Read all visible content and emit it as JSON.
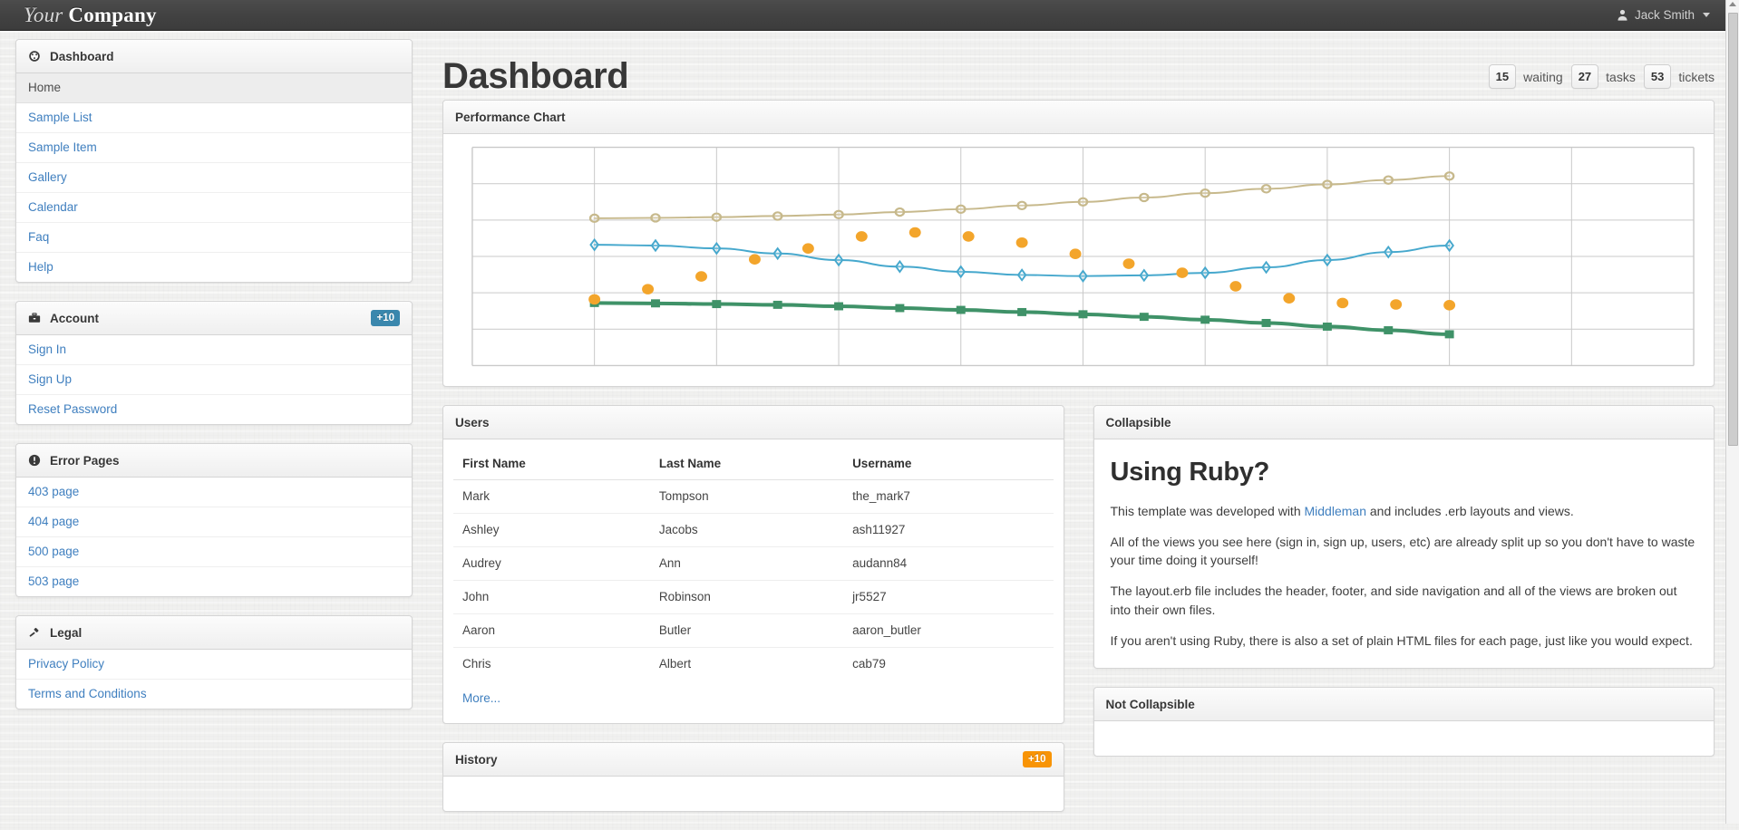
{
  "navbar": {
    "brand_first": "Your",
    "brand_second": "Company",
    "user_name": "Jack Smith",
    "user_icon": "user-icon",
    "caret_icon": "chevron-down-icon"
  },
  "sidebar": {
    "sections": [
      {
        "title": "Dashboard",
        "icon": "tachometer-icon",
        "badge": null,
        "items": [
          {
            "label": "Home",
            "active": true
          },
          {
            "label": "Sample List",
            "active": false
          },
          {
            "label": "Sample Item",
            "active": false
          },
          {
            "label": "Gallery",
            "active": false
          },
          {
            "label": "Calendar",
            "active": false
          },
          {
            "label": "Faq",
            "active": false
          },
          {
            "label": "Help",
            "active": false
          }
        ]
      },
      {
        "title": "Account",
        "icon": "briefcase-icon",
        "badge": "+10",
        "badge_color": "#3a87ad",
        "items": [
          {
            "label": "Sign In",
            "active": false
          },
          {
            "label": "Sign Up",
            "active": false
          },
          {
            "label": "Reset Password",
            "active": false
          }
        ]
      },
      {
        "title": "Error Pages",
        "icon": "exclamation-circle-icon",
        "badge": null,
        "items": [
          {
            "label": "403 page",
            "active": false
          },
          {
            "label": "404 page",
            "active": false
          },
          {
            "label": "500 page",
            "active": false
          },
          {
            "label": "503 page",
            "active": false
          }
        ]
      },
      {
        "title": "Legal",
        "icon": "gavel-icon",
        "badge": null,
        "items": [
          {
            "label": "Privacy Policy",
            "active": false
          },
          {
            "label": "Terms and Conditions",
            "active": false
          }
        ]
      }
    ]
  },
  "main": {
    "page_title": "Dashboard",
    "stats": [
      {
        "value": "15",
        "label": "waiting"
      },
      {
        "value": "27",
        "label": "tasks"
      },
      {
        "value": "53",
        "label": "tickets"
      }
    ],
    "chart_panel_title": "Performance Chart",
    "users_panel": {
      "title": "Users",
      "columns": [
        "First Name",
        "Last Name",
        "Username"
      ],
      "rows": [
        [
          "Mark",
          "Tompson",
          "the_mark7"
        ],
        [
          "Ashley",
          "Jacobs",
          "ash11927"
        ],
        [
          "Audrey",
          "Ann",
          "audann84"
        ],
        [
          "John",
          "Robinson",
          "jr5527"
        ],
        [
          "Aaron",
          "Butler",
          "aaron_butler"
        ],
        [
          "Chris",
          "Albert",
          "cab79"
        ]
      ],
      "more_label": "More..."
    },
    "collapsible_panel": {
      "title": "Collapsible",
      "heading": "Using Ruby?",
      "para1_before": "This template was developed with ",
      "para1_link": "Middleman",
      "para1_after": " and includes .erb layouts and views.",
      "para2": "All of the views you see here (sign in, sign up, users, etc) are already split up so you don't have to waste your time doing it yourself!",
      "para3": "The layout.erb file includes the header, footer, and side navigation and all of the views are broken out into their own files.",
      "para4": "If you aren't using Ruby, there is also a set of plain HTML files for each page, just like you would expect."
    },
    "history_panel": {
      "title": "History",
      "badge": "+10",
      "badge_color": "#f89406"
    },
    "not_collapsible_panel": {
      "title": "Not Collapsible"
    }
  },
  "chart_data": {
    "type": "line",
    "title": "Performance Chart",
    "xlabel": "",
    "ylabel": "",
    "grid": true,
    "legend": "none",
    "xlim": [
      0,
      10
    ],
    "ylim": [
      0,
      6
    ],
    "grid_cols": 10,
    "grid_rows": 6,
    "x": [
      1,
      1.5,
      2,
      2.5,
      3,
      3.5,
      4,
      4.5,
      5,
      5.5,
      6,
      6.5,
      7,
      7.5,
      8
    ],
    "series": [
      {
        "name": "tan-series",
        "type": "line",
        "color": "#c7b98c",
        "marker": "circle",
        "values": [
          4.05,
          4.06,
          4.08,
          4.11,
          4.15,
          4.22,
          4.3,
          4.4,
          4.5,
          4.62,
          4.74,
          4.86,
          4.98,
          5.1,
          5.21
        ]
      },
      {
        "name": "blue-series",
        "type": "line",
        "color": "#46a8cd",
        "marker": "diamond",
        "values": [
          3.32,
          3.3,
          3.22,
          3.08,
          2.9,
          2.72,
          2.58,
          2.49,
          2.46,
          2.48,
          2.55,
          2.7,
          2.9,
          3.12,
          3.3
        ]
      },
      {
        "name": "green-series",
        "type": "line",
        "color": "#3f9268",
        "marker": "square",
        "values": [
          1.72,
          1.71,
          1.69,
          1.67,
          1.63,
          1.58,
          1.53,
          1.47,
          1.41,
          1.34,
          1.26,
          1.17,
          1.07,
          0.97,
          0.86
        ]
      },
      {
        "name": "orange-scatter",
        "type": "scatter",
        "color": "#f3a52b",
        "marker": "dot",
        "values": [
          1.82,
          2.1,
          2.45,
          2.92,
          3.22,
          3.55,
          3.66,
          3.55,
          3.38,
          3.07,
          2.8,
          2.55,
          2.18,
          1.85,
          1.72,
          1.68,
          1.66
        ]
      }
    ]
  }
}
